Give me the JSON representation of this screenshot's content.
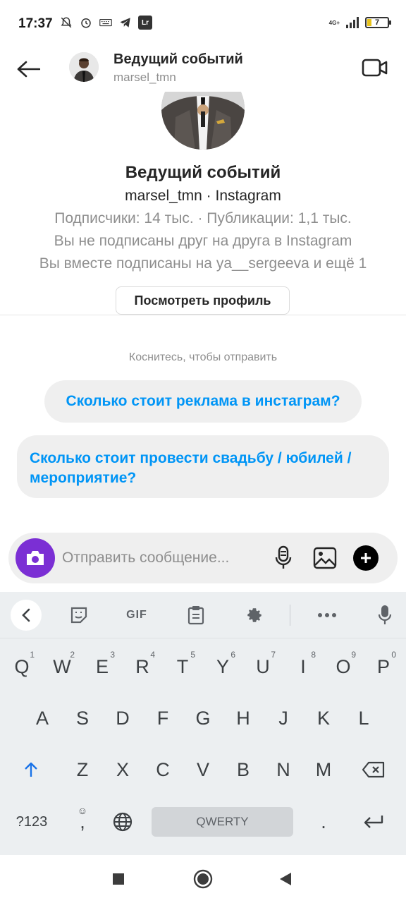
{
  "status_bar": {
    "time": "17:37",
    "network": "4G+",
    "battery": "7",
    "left_icons": [
      "mute-icon",
      "alarm-icon",
      "keyboard-icon",
      "telegram-icon",
      "lightroom-icon"
    ],
    "lightroom_badge": "Lr"
  },
  "header": {
    "name": "Ведущий событий",
    "username": "marsel_tmn"
  },
  "profile": {
    "name": "Ведущий событий",
    "subtitle": "marsel_tmn · Instagram",
    "stats": "Подписчики: 14 тыс. · Публикации: 1,1 тыс.",
    "follow_status": "Вы не подписаны друг на друга в Instagram",
    "mutual": "Вы вместе подписаны на ya__sergeeva и ещё 1",
    "view_profile_label": "Посмотреть профиль"
  },
  "suggestions": {
    "hint": "Коснитесь, чтобы отправить",
    "items": [
      "Сколько стоит реклама в инстаграм?",
      "Сколько стоит провести свадьбу / юбилей / мероприятие?"
    ]
  },
  "composer": {
    "placeholder": "Отправить сообщение..."
  },
  "keyboard": {
    "gif_label": "GIF",
    "row1": [
      {
        "key": "Q",
        "num": "1"
      },
      {
        "key": "W",
        "num": "2"
      },
      {
        "key": "E",
        "num": "3"
      },
      {
        "key": "R",
        "num": "4"
      },
      {
        "key": "T",
        "num": "5"
      },
      {
        "key": "Y",
        "num": "6"
      },
      {
        "key": "U",
        "num": "7"
      },
      {
        "key": "I",
        "num": "8"
      },
      {
        "key": "O",
        "num": "9"
      },
      {
        "key": "P",
        "num": "0"
      }
    ],
    "row2": [
      "A",
      "S",
      "D",
      "F",
      "G",
      "H",
      "J",
      "K",
      "L"
    ],
    "row3": [
      "Z",
      "X",
      "C",
      "V",
      "B",
      "N",
      "M"
    ],
    "symbols_label": "?123",
    "comma_label": ",",
    "space_label": "QWERTY",
    "period_label": "."
  },
  "colors": {
    "accent_blue": "#0095f6",
    "camera_purple": "#7b2fd4",
    "keyboard_bg": "#eceff1"
  }
}
